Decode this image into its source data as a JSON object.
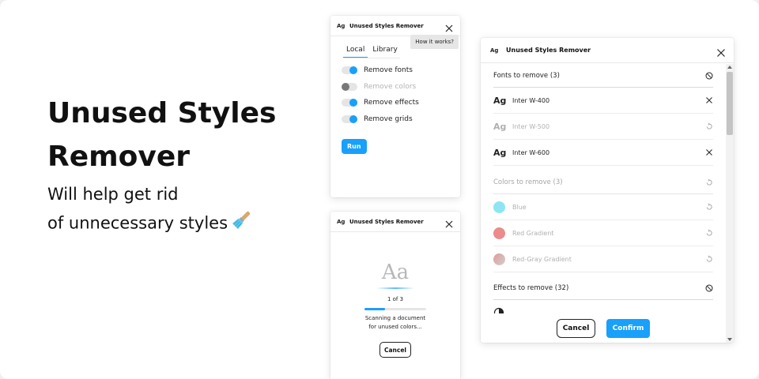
{
  "hero": {
    "title_line1": "Unused Styles",
    "title_line2": "Remover",
    "subtitle_line1": "Will help get rid",
    "subtitle_line2": "of unnecessary styles"
  },
  "colors": {
    "accent": "#18a0fb",
    "text": "#111111",
    "muted": "#b0b0b0"
  },
  "window_settings": {
    "logo": "Ag",
    "title": "Unused Styles Remover",
    "how_it_works": "How it works?",
    "tabs": [
      {
        "label": "Local",
        "active": true
      },
      {
        "label": "Library",
        "active": false
      }
    ],
    "options": [
      {
        "label": "Remove fonts",
        "enabled": true
      },
      {
        "label": "Remove colors",
        "enabled": false
      },
      {
        "label": "Remove effects",
        "enabled": true
      },
      {
        "label": "Remove grids",
        "enabled": true
      }
    ],
    "run_label": "Run"
  },
  "window_progress": {
    "logo": "Ag",
    "title": "Unused Styles Remover",
    "preview_glyph": "Aa",
    "progress_text": "1 of 3",
    "progress_fraction": 0.333,
    "scan_line1": "Scanning a document",
    "scan_line2": "for unused colors...",
    "cancel_label": "Cancel"
  },
  "window_results": {
    "logo": "Ag",
    "title": "Unused Styles Remover",
    "fonts_section": "Fonts to remove (3)",
    "fonts": [
      {
        "glyph": "Ag",
        "name": "Inter W-400",
        "kept": false
      },
      {
        "glyph": "Ag",
        "name": "Inter W-500",
        "kept": true
      },
      {
        "glyph": "Ag",
        "name": "Inter W-600",
        "kept": false
      }
    ],
    "colors_section": "Colors to remove (3)",
    "colors": [
      {
        "name": "Blue",
        "swatch": "#8de6f2"
      },
      {
        "name": "Red Gradient",
        "swatch": "#eb8b8b"
      },
      {
        "name": "Red-Gray Gradient",
        "swatch": "#e09a9a"
      }
    ],
    "effects_section": "Effects to remove (32)",
    "cancel_label": "Cancel",
    "confirm_label": "Confirm"
  }
}
